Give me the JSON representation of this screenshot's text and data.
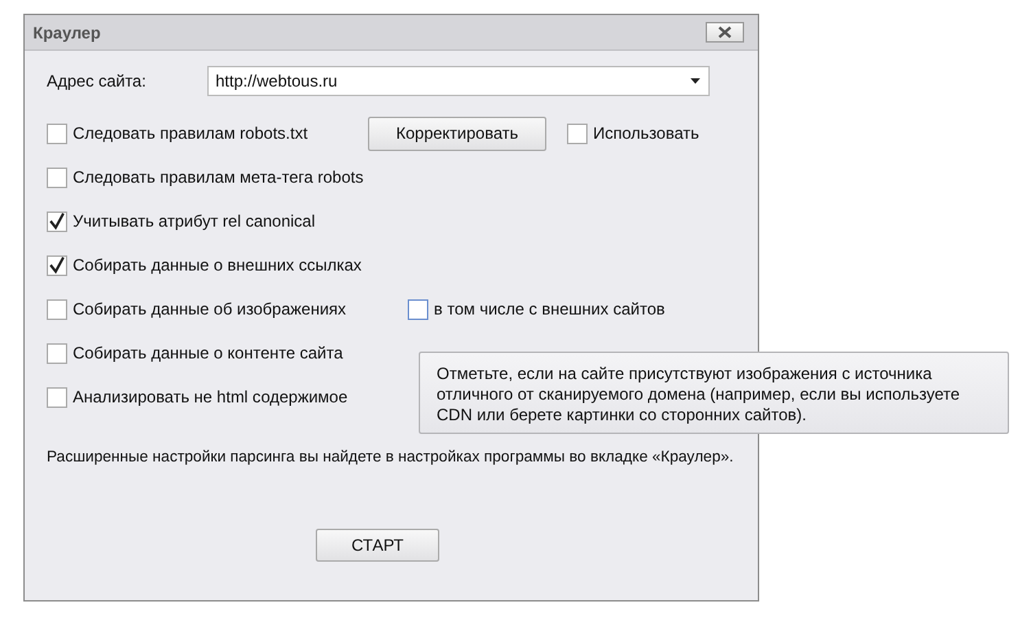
{
  "window": {
    "title": "Краулер"
  },
  "address": {
    "label": "Адрес сайта:",
    "value": "http://webtous.ru"
  },
  "options": [
    {
      "label": "Следовать правилам robots.txt",
      "checked": false,
      "button": "Корректировать",
      "extra": {
        "label": "Использовать",
        "checked": false
      }
    },
    {
      "label": "Следовать правилам мета-тега robots",
      "checked": false
    },
    {
      "label": "Учитывать атрибут rel canonical",
      "checked": true
    },
    {
      "label": "Собирать данные о внешних ссылках",
      "checked": true
    },
    {
      "label": "Собирать данные об изображениях",
      "checked": false,
      "extra": {
        "label": "в том числе с внешних сайтов",
        "checked": false
      }
    },
    {
      "label": "Собирать данные о контенте сайта",
      "checked": false
    },
    {
      "label": "Анализировать не html содержимое",
      "checked": false
    }
  ],
  "note": "Расширенные настройки парсинга вы найдете в настройках программы во вкладке «Краулер».",
  "start_button": "СТАРТ",
  "tooltip": "Отметьте, если на сайте присутствуют изображения с источника отличного от сканируемого домена (например, если вы используете CDN или берете картинки со сторонних сайтов)."
}
